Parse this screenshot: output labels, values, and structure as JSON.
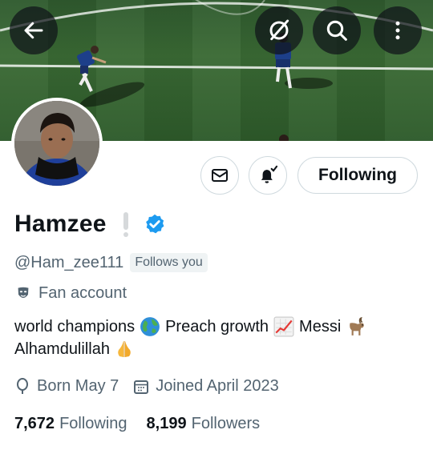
{
  "header": {
    "back_icon": "arrow-left-icon",
    "grok_icon": "grok-slash-circle-icon",
    "search_icon": "search-icon",
    "more_icon": "vertical-ellipsis-icon"
  },
  "actions": {
    "message_icon": "envelope-icon",
    "notify_icon": "bell-check-icon",
    "follow_label": "Following"
  },
  "profile": {
    "display_name": "Hamzee",
    "handle": "@Ham_zee111",
    "follows_you": "Follows you",
    "category": "Fan account",
    "bio": {
      "line1_a": "world champions",
      "line1_b": "Preach growth",
      "line1_c": "Messi",
      "line2": "Alhamdulillah"
    },
    "born": "Born May 7",
    "joined": "Joined April 2023",
    "following_count": "7,672",
    "following_label": "Following",
    "followers_count": "8,199",
    "followers_label": "Followers"
  },
  "colors": {
    "verified_blue": "#1d9bf0",
    "text_primary": "#0f1419",
    "text_secondary": "#536471",
    "border": "#cfd9de"
  }
}
